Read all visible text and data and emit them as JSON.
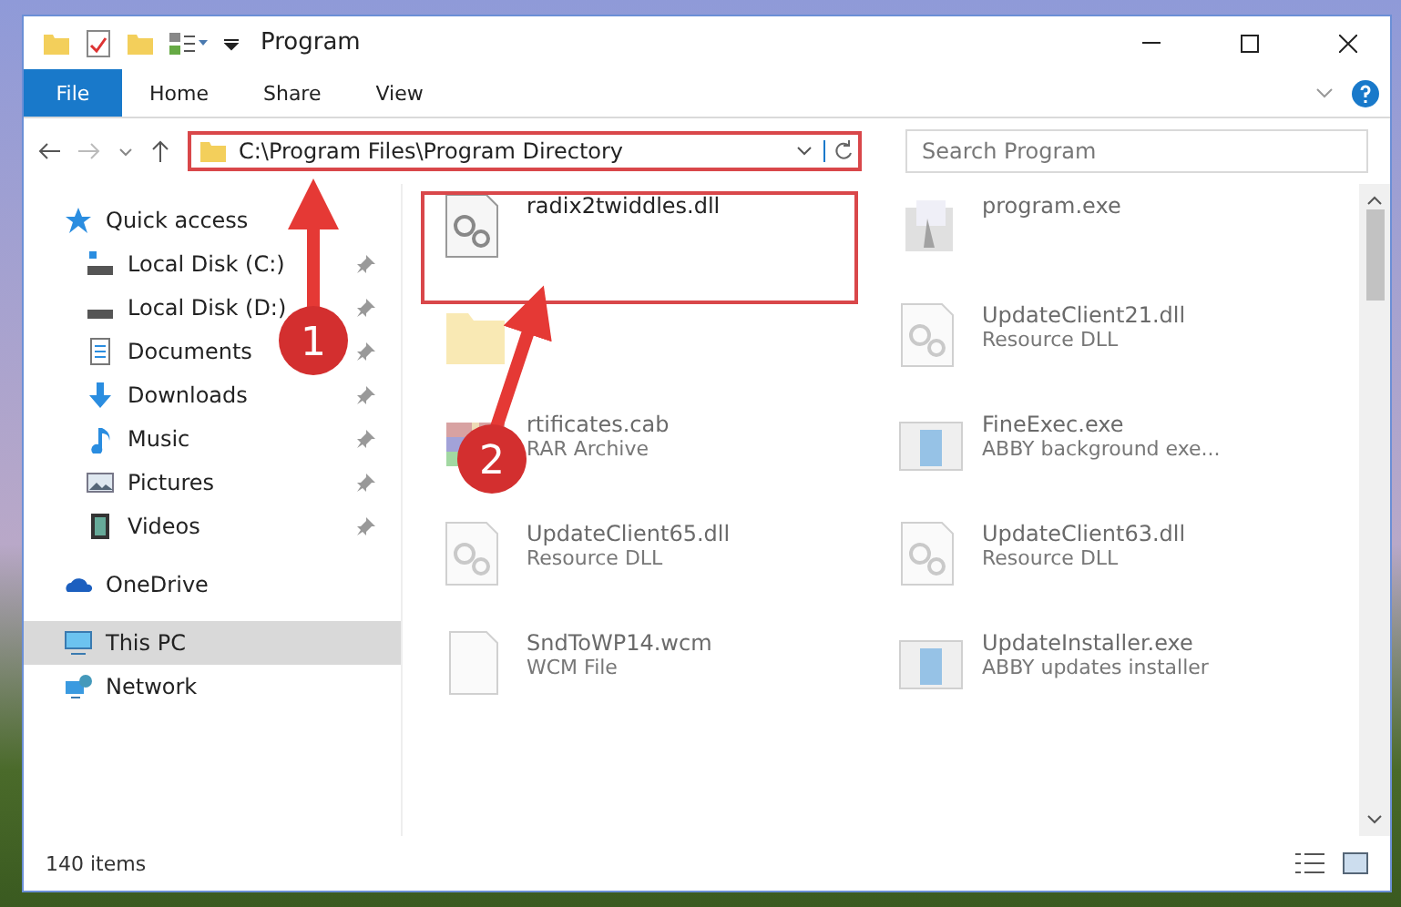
{
  "window": {
    "title": "Program"
  },
  "ribbon_tabs": [
    {
      "label": "File",
      "kind": "file"
    },
    {
      "label": "Home",
      "kind": "tab"
    },
    {
      "label": "Share",
      "kind": "tab"
    },
    {
      "label": "View",
      "kind": "tab"
    }
  ],
  "address_bar": {
    "path": "C:\\Program Files\\Program Directory",
    "highlighted": true
  },
  "search": {
    "placeholder": "Search Program"
  },
  "sidebar": [
    {
      "label": "Quick access",
      "kind": "star",
      "selected": false,
      "children": [
        {
          "label": "Local Disk (C:)",
          "kind": "drive-c",
          "pinned": true,
          "selected": false
        },
        {
          "label": "Local Disk (D:)",
          "kind": "drive",
          "pinned": true,
          "selected": false
        },
        {
          "label": "Documents",
          "kind": "documents",
          "pinned": true,
          "selected": false
        },
        {
          "label": "Downloads",
          "kind": "downloads",
          "pinned": true,
          "selected": false
        },
        {
          "label": "Music",
          "kind": "music",
          "pinned": true,
          "selected": false
        },
        {
          "label": "Pictures",
          "kind": "pictures",
          "pinned": true,
          "selected": false
        },
        {
          "label": "Videos",
          "kind": "videos",
          "pinned": true,
          "selected": false
        }
      ]
    },
    {
      "label": "OneDrive",
      "kind": "cloud",
      "selected": false
    },
    {
      "label": "This PC",
      "kind": "pc",
      "selected": true
    },
    {
      "label": "Network",
      "kind": "network",
      "selected": false
    }
  ],
  "files": [
    {
      "name": "radix2twiddles.dll",
      "kind": "dll",
      "faded": false,
      "highlighted": true
    },
    {
      "name": "program.exe",
      "kind": "app",
      "faded": true,
      "highlighted": false
    },
    {
      "kind": "folder",
      "faded": true,
      "highlighted": false
    },
    {
      "name": "UpdateClient21.dll",
      "type": "Resource DLL",
      "kind": "dll",
      "faded": true,
      "highlighted": false
    },
    {
      "name": "rtificates.cab",
      "type": "RAR Archive",
      "kind": "archive",
      "faded": true,
      "highlighted": false
    },
    {
      "name": "FineExec.exe",
      "type": "ABBY background exe...",
      "kind": "window",
      "faded": true,
      "highlighted": false
    },
    {
      "name": "UpdateClient65.dll",
      "type": "Resource DLL",
      "kind": "dll",
      "faded": true,
      "highlighted": false
    },
    {
      "name": "UpdateClient63.dll",
      "type": "Resource DLL",
      "kind": "dll",
      "faded": true,
      "highlighted": false
    },
    {
      "name": "SndToWP14.wcm",
      "type": "WCM File",
      "kind": "file",
      "faded": true,
      "highlighted": false
    },
    {
      "name": "UpdateInstaller.exe",
      "type": "ABBY updates installer",
      "kind": "window",
      "faded": true,
      "highlighted": false
    }
  ],
  "status_bar": {
    "count": "140 items"
  },
  "callouts": [
    {
      "label": "1"
    },
    {
      "label": "2"
    }
  ]
}
